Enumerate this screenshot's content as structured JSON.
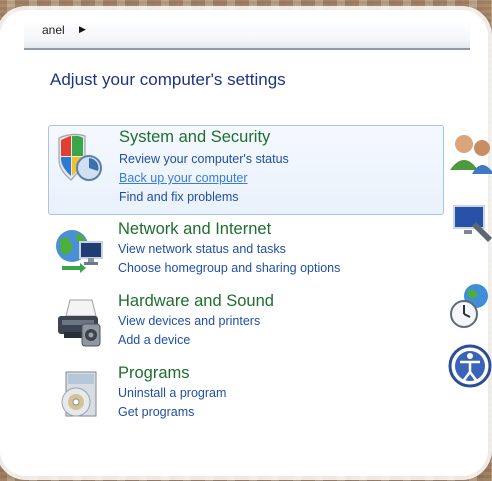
{
  "address": {
    "breadcrumb": "anel"
  },
  "page": {
    "title": "Adjust your computer's settings"
  },
  "categories": [
    {
      "title": "System and Security",
      "icon": "shield-icon",
      "links": [
        "Review your computer's status",
        "Back up your computer",
        "Find and fix problems"
      ]
    },
    {
      "title": "Network and Internet",
      "icon": "network-icon",
      "links": [
        "View network status and tasks",
        "Choose homegroup and sharing options"
      ]
    },
    {
      "title": "Hardware and Sound",
      "icon": "printer-icon",
      "links": [
        "View devices and printers",
        "Add a device"
      ]
    },
    {
      "title": "Programs",
      "icon": "programs-icon",
      "links": [
        "Uninstall a program",
        "Get programs"
      ]
    }
  ],
  "right_column_icons": [
    "user-accounts-icon",
    "appearance-icon",
    "clock-language-region-icon",
    "ease-of-access-icon"
  ],
  "colors": {
    "title": "#1e3287",
    "category_title": "#1e6e2e",
    "link": "#1f4fa5",
    "link_hover": "#3a7bd5"
  }
}
